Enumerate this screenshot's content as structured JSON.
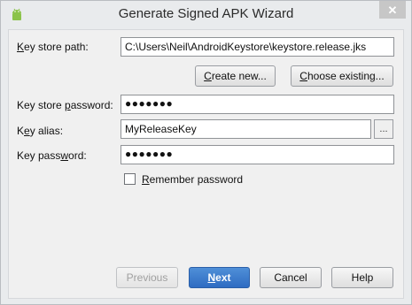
{
  "window": {
    "title": "Generate Signed APK Wizard"
  },
  "icons": {
    "app": "android-icon",
    "close": "close-icon"
  },
  "form": {
    "key_store_path": {
      "label_first": "K",
      "label_rest": "ey store path:",
      "value": "C:\\Users\\Neil\\AndroidKeystore\\keystore.release.jks"
    },
    "create_new_first": "C",
    "create_new_rest": "reate new...",
    "choose_existing_first": "C",
    "choose_existing_rest": "hoose existing...",
    "key_store_password": {
      "label_before": "Key store ",
      "label_u": "p",
      "label_after": "assword:",
      "masked": "●●●●●●●"
    },
    "key_alias": {
      "label_before": "K",
      "label_u": "e",
      "label_after": "y alias:",
      "value": "MyReleaseKey",
      "browse": "..."
    },
    "key_password": {
      "label_before": "Key pass",
      "label_u": "w",
      "label_after": "ord:",
      "masked": "●●●●●●●"
    },
    "remember": {
      "label_u": "R",
      "label_rest": "emember password",
      "checked": false
    }
  },
  "buttons": {
    "previous": "Previous",
    "next_u": "N",
    "next_rest": "ext",
    "cancel": "Cancel",
    "help": "Help"
  },
  "colors": {
    "primary": "#2f6cc2",
    "window_bg": "#e9ebed",
    "content_bg": "#f0f0f0"
  }
}
